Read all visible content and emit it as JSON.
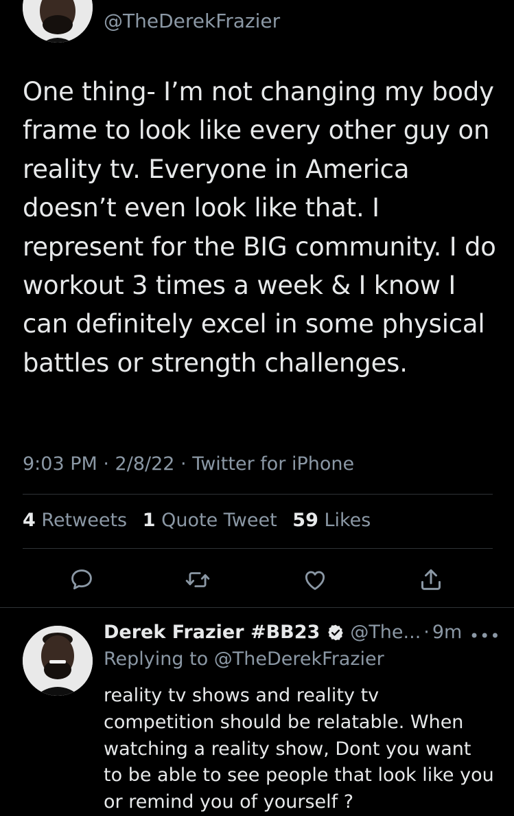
{
  "tweet": {
    "handle": "@TheDerekFrazier",
    "text": "One thing- I’m not changing my body frame to look like every other guy on reality tv. Everyone in America doesn’t even look like that. I represent for the BIG community. I do workout 3 times a week & I know I can definitely excel in some physical battles or strength challenges.",
    "meta": "9:03 PM · 2/8/22 · Twitter for iPhone",
    "stats": {
      "retweets_count": "4",
      "retweets_label": "Retweets",
      "quotes_count": "1",
      "quotes_label": "Quote Tweet",
      "likes_count": "59",
      "likes_label": "Likes"
    },
    "actions": [
      "reply-icon",
      "retweet-icon",
      "like-icon",
      "share-icon"
    ]
  },
  "reply": {
    "name": "Derek Frazier #BB23",
    "handle": "@The...",
    "separator": "·",
    "time": "9m",
    "more": "•••",
    "replying_to": "Replying to @TheDerekFrazier",
    "text": "reality tv shows and reality tv competition should be relatable. When watching a reality show, Dont you want to be able to see people that look like you or remind you of yourself ?"
  },
  "colors": {
    "background": "#000000",
    "text_primary": "#e7e9ea",
    "text_secondary": "#8b98a5",
    "divider": "#2f3336"
  }
}
